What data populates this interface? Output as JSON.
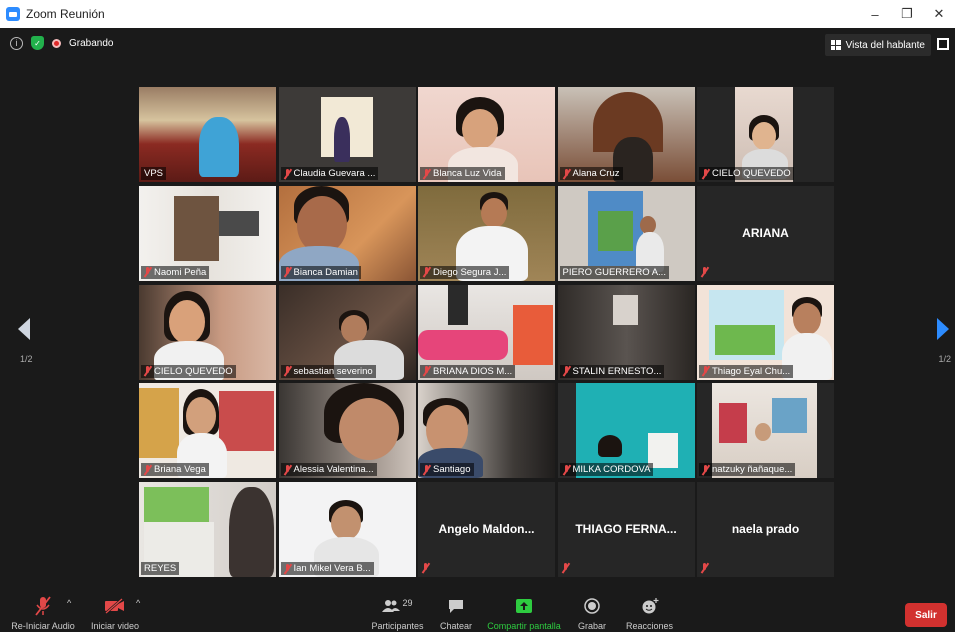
{
  "window": {
    "title": "Zoom Reunión",
    "controls": [
      "–",
      "❐",
      "✕"
    ]
  },
  "topbar": {
    "recording_label": "Grabando",
    "speaker_view_label": "Vista del hablante"
  },
  "navigation": {
    "page_left": "1/2",
    "page_right": "1/2"
  },
  "participants": [
    {
      "name": "VPS",
      "muted": false,
      "video": true
    },
    {
      "name": "Claudia Guevara ...",
      "muted": true,
      "video": true
    },
    {
      "name": "Blanca Luz Vida",
      "muted": true,
      "video": true
    },
    {
      "name": "Alana Cruz",
      "muted": true,
      "video": true
    },
    {
      "name": "CIELO QUEVEDO",
      "muted": true,
      "video": true
    },
    {
      "name": "Naomi  Peña",
      "muted": true,
      "video": true
    },
    {
      "name": "Bianca Damian",
      "muted": true,
      "video": true
    },
    {
      "name": "Diego Segura J...",
      "muted": true,
      "video": true
    },
    {
      "name": "PIERO GUERRERO A...",
      "muted": false,
      "video": true,
      "active": true
    },
    {
      "name": "ARIANA",
      "muted": true,
      "video": false
    },
    {
      "name": "CIELO QUEVEDO",
      "muted": true,
      "video": true
    },
    {
      "name": "sebastian severino",
      "muted": true,
      "video": true
    },
    {
      "name": "BRIANA DIOS M...",
      "muted": true,
      "video": true
    },
    {
      "name": "STALIN ERNESTO...",
      "muted": true,
      "video": true
    },
    {
      "name": "Thiago Eyal Chu...",
      "muted": true,
      "video": true
    },
    {
      "name": "Briana Vega",
      "muted": true,
      "video": true
    },
    {
      "name": "Alessia Valentina...",
      "muted": true,
      "video": true
    },
    {
      "name": "Santiago",
      "muted": true,
      "video": true
    },
    {
      "name": "MILKA CORDOVA",
      "muted": true,
      "video": true
    },
    {
      "name": "natzuky ñañaque...",
      "muted": true,
      "video": true
    },
    {
      "name": "REYES",
      "muted": false,
      "video": true
    },
    {
      "name": "Ian Mikel Vera B...",
      "muted": true,
      "video": true
    },
    {
      "name": "Angelo  Maldon...",
      "muted": true,
      "video": false
    },
    {
      "name": "THIAGO FERNA...",
      "muted": true,
      "video": false
    },
    {
      "name": "naela prado",
      "muted": true,
      "video": false
    }
  ],
  "toolbar": {
    "audio_label": "Re-Iniciar Audio",
    "video_label": "Iniciar video",
    "participants_label": "Participantes",
    "participants_count": "29",
    "chat_label": "Chatear",
    "share_label": "Compartir pantalla",
    "record_label": "Grabar",
    "reactions_label": "Reacciones",
    "leave_label": "Salir"
  },
  "colors": {
    "share_green": "#2ecc40",
    "leave_red": "#d2312f",
    "active_border": "#d7e65c",
    "accent_blue": "#2d8cff"
  }
}
